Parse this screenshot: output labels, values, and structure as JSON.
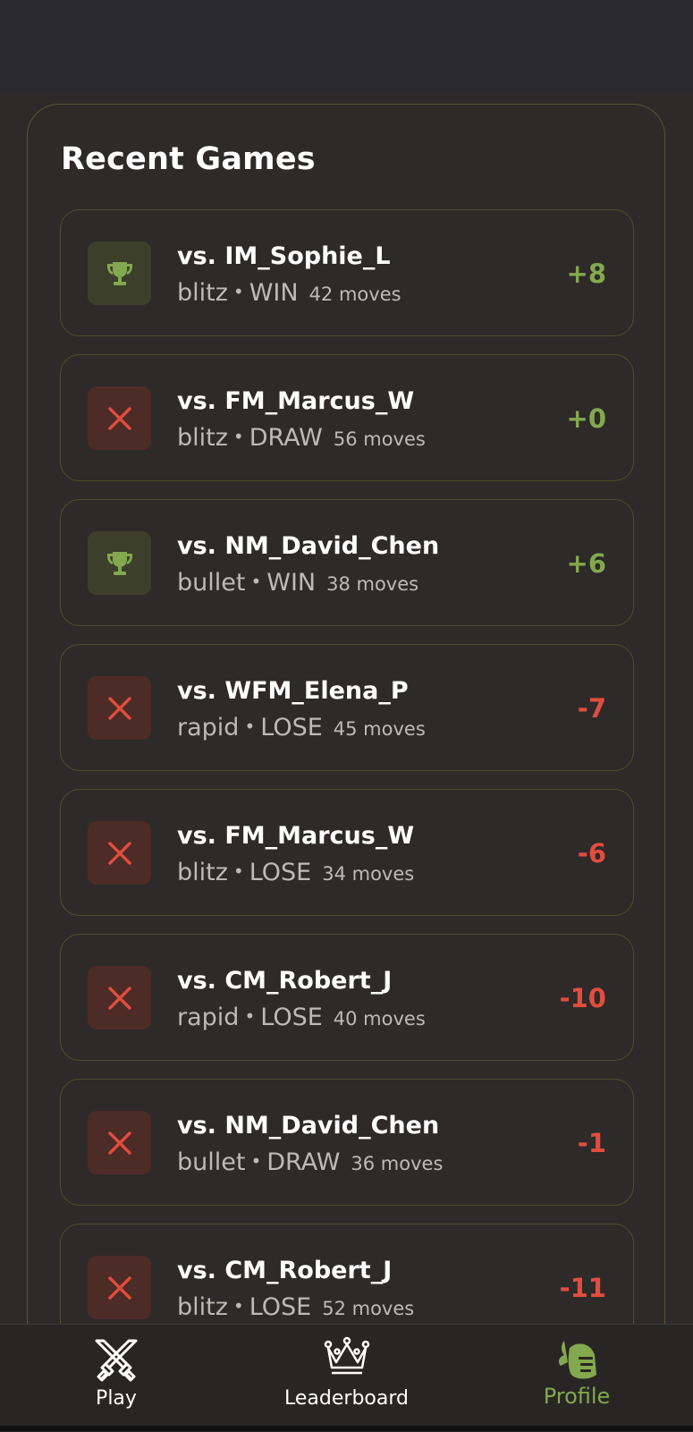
{
  "section": {
    "title": "Recent Games"
  },
  "games": [
    {
      "opponent": "vs. IM_Sophie_L",
      "mode": "blitz",
      "result": "WIN",
      "moves": "42 moves",
      "delta": "+8",
      "outcome": "win"
    },
    {
      "opponent": "vs. FM_Marcus_W",
      "mode": "blitz",
      "result": "DRAW",
      "moves": "56 moves",
      "delta": "+0",
      "outcome": "loss"
    },
    {
      "opponent": "vs. NM_David_Chen",
      "mode": "bullet",
      "result": "WIN",
      "moves": "38 moves",
      "delta": "+6",
      "outcome": "win"
    },
    {
      "opponent": "vs. WFM_Elena_P",
      "mode": "rapid",
      "result": "LOSE",
      "moves": "45 moves",
      "delta": "-7",
      "outcome": "loss"
    },
    {
      "opponent": "vs. FM_Marcus_W",
      "mode": "blitz",
      "result": "LOSE",
      "moves": "34 moves",
      "delta": "-6",
      "outcome": "loss"
    },
    {
      "opponent": "vs. CM_Robert_J",
      "mode": "rapid",
      "result": "LOSE",
      "moves": "40 moves",
      "delta": "-10",
      "outcome": "loss"
    },
    {
      "opponent": "vs. NM_David_Chen",
      "mode": "bullet",
      "result": "DRAW",
      "moves": "36 moves",
      "delta": "-1",
      "outcome": "loss"
    },
    {
      "opponent": "vs. CM_Robert_J",
      "mode": "blitz",
      "result": "LOSE",
      "moves": "52 moves",
      "delta": "-11",
      "outcome": "loss"
    }
  ],
  "separator": "•",
  "nav": {
    "play": {
      "label": "Play",
      "icon": "crossed-swords-icon"
    },
    "leaderboard": {
      "label": "Leaderboard",
      "icon": "crown-icon"
    },
    "profile": {
      "label": "Profile",
      "icon": "knight-helmet-icon",
      "active": true
    }
  },
  "colors": {
    "accent_green": "#83a84e",
    "loss_red": "#e14d3e",
    "background": "#2e2a29"
  }
}
